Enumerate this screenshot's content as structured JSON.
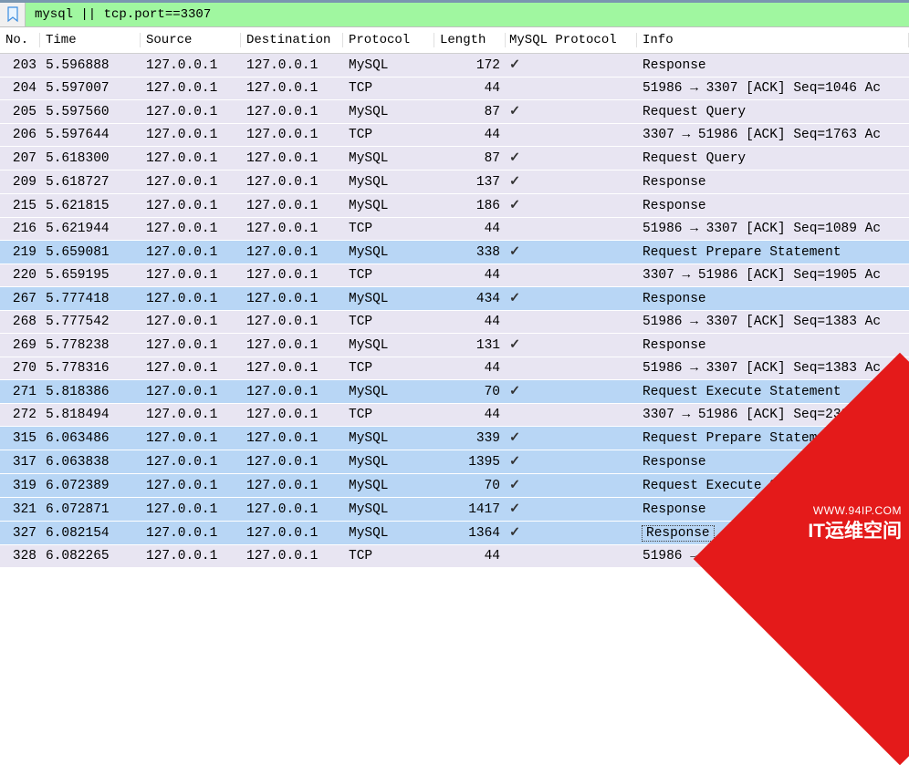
{
  "filter": {
    "value": "mysql || tcp.port==3307"
  },
  "columns": {
    "no": "No.",
    "time": "Time",
    "source": "Source",
    "destination": "Destination",
    "protocol": "Protocol",
    "length": "Length",
    "mysql_protocol": "MySQL Protocol",
    "info": "Info"
  },
  "checkmark": "✓",
  "rows": [
    {
      "no": "203",
      "time": "5.596888",
      "src": "127.0.0.1",
      "dst": "127.0.0.1",
      "proto": "MySQL",
      "len": "172",
      "mysql": true,
      "info": "Response",
      "cls": "row-lavender"
    },
    {
      "no": "204",
      "time": "5.597007",
      "src": "127.0.0.1",
      "dst": "127.0.0.1",
      "proto": "TCP",
      "len": "44",
      "mysql": false,
      "info": "51986 → 3307 [ACK] Seq=1046 Ac",
      "cls": "row-lavender"
    },
    {
      "no": "205",
      "time": "5.597560",
      "src": "127.0.0.1",
      "dst": "127.0.0.1",
      "proto": "MySQL",
      "len": "87",
      "mysql": true,
      "info": "Request Query",
      "cls": "row-lavender"
    },
    {
      "no": "206",
      "time": "5.597644",
      "src": "127.0.0.1",
      "dst": "127.0.0.1",
      "proto": "TCP",
      "len": "44",
      "mysql": false,
      "info": "3307 → 51986 [ACK] Seq=1763 Ac",
      "cls": "row-lavender"
    },
    {
      "no": "207",
      "time": "5.618300",
      "src": "127.0.0.1",
      "dst": "127.0.0.1",
      "proto": "MySQL",
      "len": "87",
      "mysql": true,
      "info": "Request Query",
      "cls": "row-lavender"
    },
    {
      "no": "209",
      "time": "5.618727",
      "src": "127.0.0.1",
      "dst": "127.0.0.1",
      "proto": "MySQL",
      "len": "137",
      "mysql": true,
      "info": "Response",
      "cls": "row-lavender"
    },
    {
      "no": "215",
      "time": "5.621815",
      "src": "127.0.0.1",
      "dst": "127.0.0.1",
      "proto": "MySQL",
      "len": "186",
      "mysql": true,
      "info": "Response",
      "cls": "row-lavender"
    },
    {
      "no": "216",
      "time": "5.621944",
      "src": "127.0.0.1",
      "dst": "127.0.0.1",
      "proto": "TCP",
      "len": "44",
      "mysql": false,
      "info": "51986 → 3307 [ACK] Seq=1089 Ac",
      "cls": "row-lavender"
    },
    {
      "no": "219",
      "time": "5.659081",
      "src": "127.0.0.1",
      "dst": "127.0.0.1",
      "proto": "MySQL",
      "len": "338",
      "mysql": true,
      "info": "Request Prepare Statement",
      "cls": "row-blue"
    },
    {
      "no": "220",
      "time": "5.659195",
      "src": "127.0.0.1",
      "dst": "127.0.0.1",
      "proto": "TCP",
      "len": "44",
      "mysql": false,
      "info": "3307 → 51986 [ACK] Seq=1905 Ac",
      "cls": "row-lavender"
    },
    {
      "no": "267",
      "time": "5.777418",
      "src": "127.0.0.1",
      "dst": "127.0.0.1",
      "proto": "MySQL",
      "len": "434",
      "mysql": true,
      "info": "Response",
      "cls": "row-blue"
    },
    {
      "no": "268",
      "time": "5.777542",
      "src": "127.0.0.1",
      "dst": "127.0.0.1",
      "proto": "TCP",
      "len": "44",
      "mysql": false,
      "info": "51986 → 3307 [ACK] Seq=1383 Ac",
      "cls": "row-lavender"
    },
    {
      "no": "269",
      "time": "5.778238",
      "src": "127.0.0.1",
      "dst": "127.0.0.1",
      "proto": "MySQL",
      "len": "131",
      "mysql": true,
      "info": "Response",
      "cls": "row-lavender"
    },
    {
      "no": "270",
      "time": "5.778316",
      "src": "127.0.0.1",
      "dst": "127.0.0.1",
      "proto": "TCP",
      "len": "44",
      "mysql": false,
      "info": "51986 → 3307 [ACK] Seq=1383 Ac",
      "cls": "row-lavender"
    },
    {
      "no": "271",
      "time": "5.818386",
      "src": "127.0.0.1",
      "dst": "127.0.0.1",
      "proto": "MySQL",
      "len": "70",
      "mysql": true,
      "info": "Request Execute Statement",
      "cls": "row-blue"
    },
    {
      "no": "272",
      "time": "5.818494",
      "src": "127.0.0.1",
      "dst": "127.0.0.1",
      "proto": "TCP",
      "len": "44",
      "mysql": false,
      "info": "3307 → 51986 [ACK] Seq=2382 Ac",
      "cls": "row-lavender"
    },
    {
      "no": "315",
      "time": "6.063486",
      "src": "127.0.0.1",
      "dst": "127.0.0.1",
      "proto": "MySQL",
      "len": "339",
      "mysql": true,
      "info": "Request Prepare Statement",
      "cls": "row-blue"
    },
    {
      "no": "317",
      "time": "6.063838",
      "src": "127.0.0.1",
      "dst": "127.0.0.1",
      "proto": "MySQL",
      "len": "1395",
      "mysql": true,
      "info": "Response",
      "cls": "row-blue"
    },
    {
      "no": "319",
      "time": "6.072389",
      "src": "127.0.0.1",
      "dst": "127.0.0.1",
      "proto": "MySQL",
      "len": "70",
      "mysql": true,
      "info": "Request Execute Statement",
      "cls": "row-blue"
    },
    {
      "no": "321",
      "time": "6.072871",
      "src": "127.0.0.1",
      "dst": "127.0.0.1",
      "proto": "MySQL",
      "len": "1417",
      "mysql": true,
      "info": "Response",
      "cls": "row-blue"
    },
    {
      "no": "327",
      "time": "6.082154",
      "src": "127.0.0.1",
      "dst": "127.0.0.1",
      "proto": "MySQL",
      "len": "1364",
      "mysql": true,
      "info": "Response",
      "cls": "row-blue",
      "focused": true
    },
    {
      "no": "328",
      "time": "6.082265",
      "src": "127.0.0.1",
      "dst": "127.0.0.1",
      "proto": "TCP",
      "len": "44",
      "mysql": false,
      "info": "51986 → 3",
      "cls": "row-lavender"
    }
  ],
  "watermark": {
    "line1": "WWW.94IP.COM",
    "line2": "IT运维空间"
  }
}
